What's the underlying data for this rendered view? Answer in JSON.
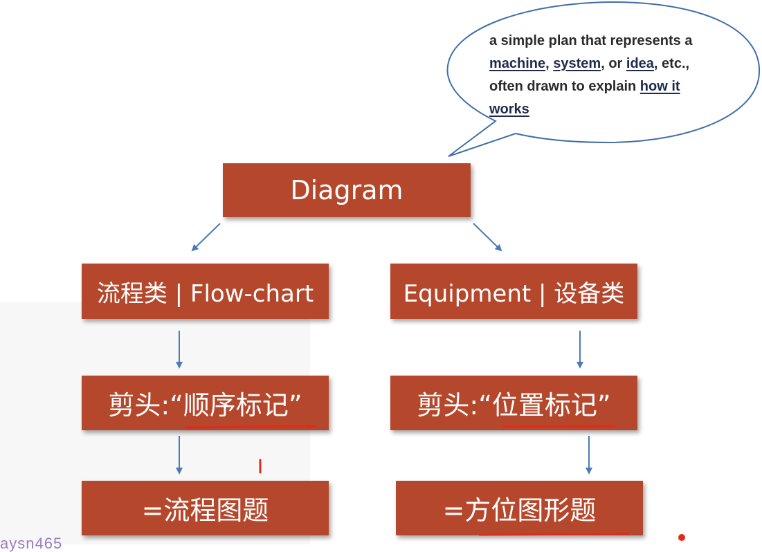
{
  "bubble": {
    "line1": "a simple plan that represents a",
    "word_machine": "machine",
    "sep1": ", ",
    "word_system": "system",
    "sep2": ", or ",
    "word_idea": "idea",
    "sep3": ", etc.,",
    "line3_prefix": "often drawn to explain ",
    "word_how_it": "how it",
    "word_works": "works"
  },
  "nodes": {
    "root": "Diagram",
    "left_category": "流程类 | Flow-chart",
    "right_category": "Equipment | 设备类",
    "left_arrow_note": "剪头:“顺序标记”",
    "right_arrow_note": "剪头:“位置标记”",
    "left_result": "=流程图题",
    "right_result": "=方位图形题"
  },
  "watermark": "aysn465",
  "colors": {
    "box_fill": "#b5482c",
    "box_text": "#ffffff",
    "arrow": "#4a7ab8",
    "bubble_stroke": "#3f6fa8",
    "annotation_red": "#e02a1a"
  }
}
